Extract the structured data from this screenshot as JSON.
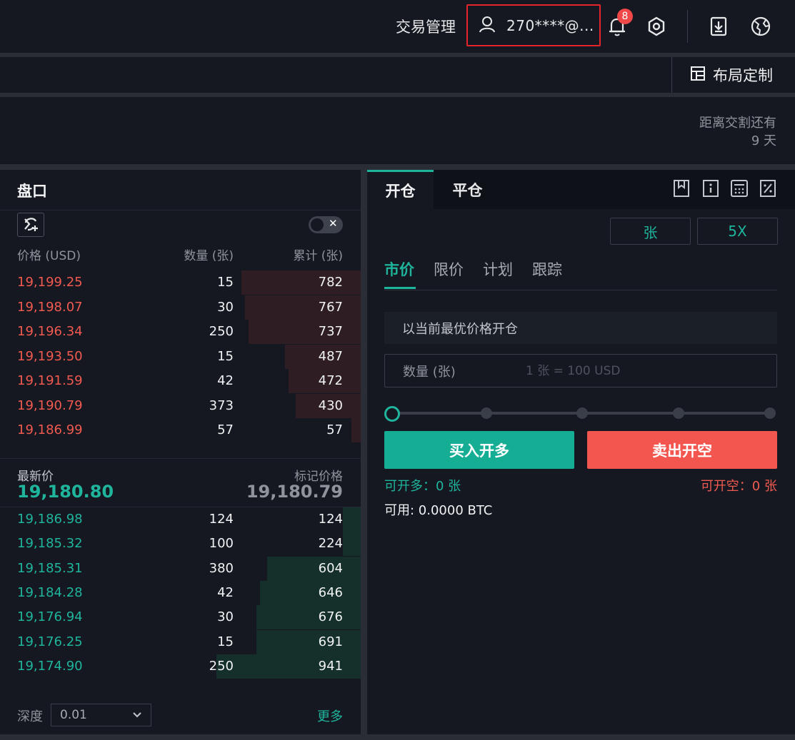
{
  "header": {
    "trade_mgmt": "交易管理",
    "user_label": "270****@...",
    "notification_count": "8"
  },
  "toolbar": {
    "layout_label": "布局定制"
  },
  "delivery": {
    "line1": "距离交割还有",
    "line2": "9 天"
  },
  "orderbook": {
    "title": "盘口",
    "col_price": "价格 (USD)",
    "col_qty": "数量 (张)",
    "col_cum": "累计 (张)",
    "asks": [
      {
        "price": "19,199.25",
        "qty": "15",
        "cum": "782",
        "depth": 0.33
      },
      {
        "price": "19,198.07",
        "qty": "30",
        "cum": "767",
        "depth": 0.32
      },
      {
        "price": "19,196.34",
        "qty": "250",
        "cum": "737",
        "depth": 0.31
      },
      {
        "price": "19,193.50",
        "qty": "15",
        "cum": "487",
        "depth": 0.21
      },
      {
        "price": "19,191.59",
        "qty": "42",
        "cum": "472",
        "depth": 0.2
      },
      {
        "price": "19,190.79",
        "qty": "373",
        "cum": "430",
        "depth": 0.18
      },
      {
        "price": "19,186.99",
        "qty": "57",
        "cum": "57",
        "depth": 0.025
      }
    ],
    "last_label": "最新价",
    "last_price": "19,180.80",
    "mark_label": "标记价格",
    "mark_price": "19,180.79",
    "bids": [
      {
        "price": "19,186.98",
        "qty": "124",
        "cum": "124",
        "depth": 0.05
      },
      {
        "price": "19,185.32",
        "qty": "100",
        "cum": "224",
        "depth": 0.05
      },
      {
        "price": "19,185.31",
        "qty": "380",
        "cum": "604",
        "depth": 0.26
      },
      {
        "price": "19,184.28",
        "qty": "42",
        "cum": "646",
        "depth": 0.28
      },
      {
        "price": "19,176.94",
        "qty": "30",
        "cum": "676",
        "depth": 0.29
      },
      {
        "price": "19,176.25",
        "qty": "15",
        "cum": "691",
        "depth": 0.29
      },
      {
        "price": "19,174.90",
        "qty": "250",
        "cum": "941",
        "depth": 0.4
      }
    ],
    "depth_label": "深度",
    "depth_value": "0.01",
    "more": "更多"
  },
  "trade": {
    "tab_open": "开仓",
    "tab_close": "平仓",
    "unit_button": "张",
    "leverage_button": "5X",
    "order_types": [
      "市价",
      "限价",
      "计划",
      "跟踪"
    ],
    "best_price_text": "以当前最优价格开仓",
    "qty_label": "数量 (张)",
    "qty_placeholder": "1 张 = 100 USD",
    "buy_label": "买入开多",
    "sell_label": "卖出开空",
    "avail_long": "可开多：0 张",
    "avail_short": "可开空：0 张",
    "available": "可用:  0.0000 BTC"
  },
  "colors": {
    "up": "#1fb59d",
    "down": "#f05a50",
    "panel": "#151820"
  }
}
